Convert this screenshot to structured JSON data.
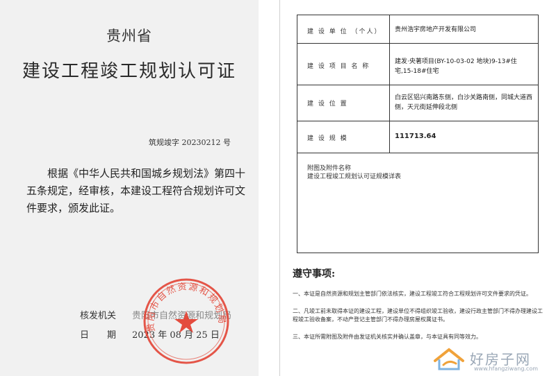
{
  "left_page": {
    "province": "贵州省",
    "title": "建设工程竣工规划认可证",
    "doc_number": "筑规竣字 20230212 号",
    "body": "根据《中华人民共和国城乡规划法》第四十五条规定，经审核，本建设工程符合规划许可文件要求，颁发此证。",
    "issuer_label": "核发机关",
    "issuer_value": "贵阳市自然资源和规划局",
    "date_label": "日　　期",
    "date_value": "2023 年 08 月 25 日",
    "seal_text": "贵阳市自然资源和规划局"
  },
  "right_page": {
    "rows": [
      {
        "label": "建 设 单 位 （个人）",
        "value": "贵州浩宇房地产开发有限公司"
      },
      {
        "label": "建 设 项 目 名 称",
        "value": "建发·央著项目(BY-10-03-02 地块)9-13#住宅,15-18#住宅"
      },
      {
        "label": "建 设 位 置",
        "value": "白云区铝兴南路东侧，白沙关路南侧，同城大道西侧，天元街延伸段北侧"
      },
      {
        "label": "建 设 规 模",
        "value": "111713.64"
      }
    ],
    "attachments_title": "附图及附件名称",
    "attachments_item": "建设工程竣工规划认可证规模详表",
    "notice_title": "遵守事项:",
    "notices": [
      "一、本证是自然资源和规划主管部门依法核实，建设工程竣工符合工程规划许可文件要求的凭证。",
      "二、凡竣工前未取得本证的建设工程，建设单位不得组织竣工验收，建设行政主管部门不得办理建设工程竣工验收备案，不动产登记主管部门不得办理房屋权属证书。",
      "三、本证所需附图及附件由发证机关核实并确认盖章，与本证具有同等效力。"
    ]
  },
  "watermark": {
    "text": "好房子网",
    "url": "www.hfangziwang.com"
  }
}
